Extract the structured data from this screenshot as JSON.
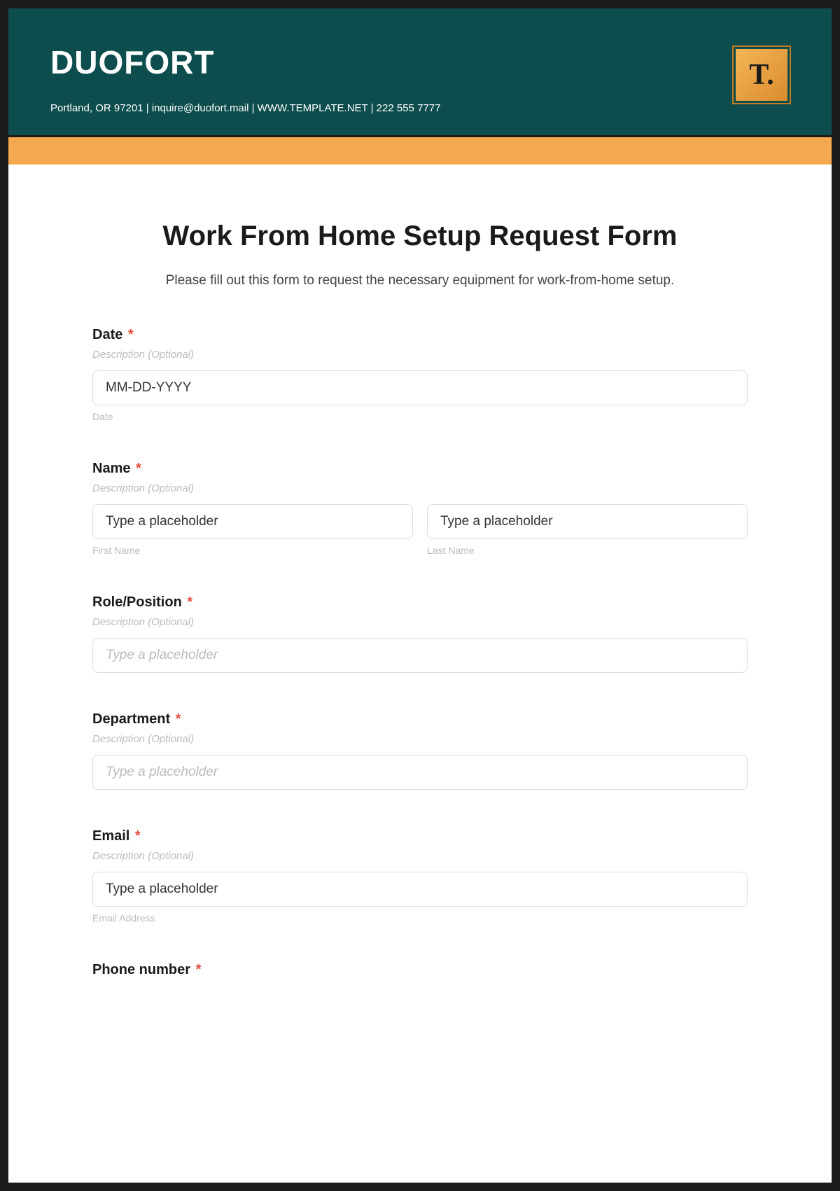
{
  "header": {
    "company_name": "DUOFORT",
    "contact_line": "Portland, OR 97201 | inquire@duofort.mail | WWW.TEMPLATE.NET | 222 555 7777",
    "logo_text": "T."
  },
  "form": {
    "title": "Work From Home Setup Request Form",
    "intro": "Please fill out this form to request the necessary equipment for work-from-home setup.",
    "required_indicator": "*",
    "description_placeholder": "Description (Optional)",
    "fields": {
      "date": {
        "label": "Date",
        "placeholder": "MM-DD-YYYY",
        "sublabel": "Date"
      },
      "name": {
        "label": "Name",
        "first_placeholder": "Type a placeholder",
        "first_sublabel": "First Name",
        "last_placeholder": "Type a placeholder",
        "last_sublabel": "Last Name"
      },
      "role": {
        "label": "Role/Position",
        "placeholder": "Type a placeholder"
      },
      "department": {
        "label": "Department",
        "placeholder": "Type a placeholder"
      },
      "email": {
        "label": "Email",
        "placeholder": "Type a placeholder",
        "sublabel": "Email Address"
      },
      "phone": {
        "label": "Phone number"
      }
    }
  }
}
